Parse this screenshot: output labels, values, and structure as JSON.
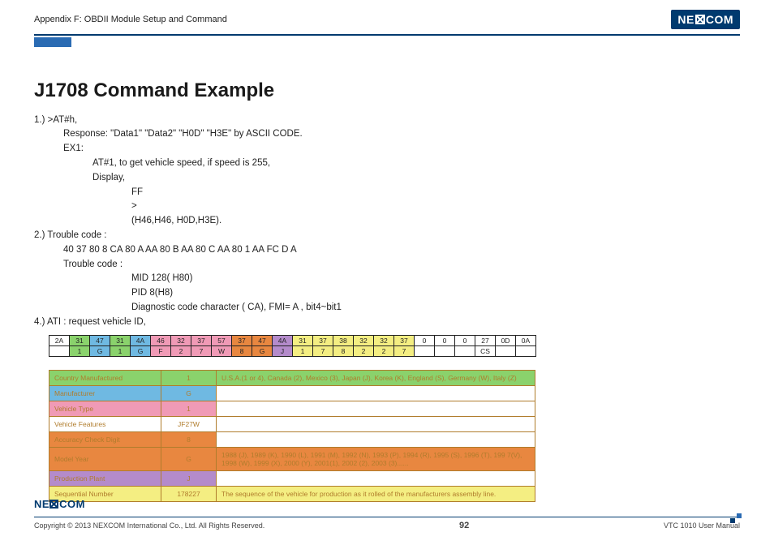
{
  "header": {
    "appendix": "Appendix F: OBDII Module Setup and Command",
    "logo_text": "NEXCOM"
  },
  "title": "J1708 Command Example",
  "lines": {
    "l1": "1.)   >AT#h,",
    "l2": "Response: \"Data1\" \"Data2\" \"H0D\" \"H3E\" by ASCII CODE.",
    "l3": "EX1:",
    "l4": "AT#1, to get vehicle speed, if speed is 255,",
    "l5": "Display,",
    "l6": "FF",
    "l7": ">",
    "l8": "(H46,H46, H0D,H3E).",
    "l9": "2.) Trouble code :",
    "l10": "40 37 80 8 CA 80 A AA 80 B AA 80 C AA 80 1 AA FC D A",
    "l11": "Trouble code :",
    "l12": "MID 128( H80)",
    "l13": "PID 8(H8)",
    "l14": "Diagnostic code character ( CA), FMI= A , bit4~bit1",
    "l15": "4.) ATI : request vehicle ID,"
  },
  "hex_table": {
    "row1": [
      "2A",
      "31",
      "47",
      "31",
      "4A",
      "46",
      "32",
      "37",
      "57",
      "37",
      "47",
      "4A",
      "31",
      "37",
      "38",
      "32",
      "32",
      "37",
      "0",
      "0",
      "0",
      "27",
      "0D",
      "0A"
    ],
    "row2": [
      "",
      "1",
      "G",
      "1",
      "G",
      "F",
      "2",
      "7",
      "W",
      "8",
      "G",
      "J",
      "1",
      "7",
      "8",
      "2",
      "2",
      "7",
      "",
      "",
      "",
      "CS",
      "",
      ""
    ],
    "colors": [
      "white",
      "green",
      "blue",
      "green",
      "blue",
      "pink",
      "pink",
      "pink",
      "pink",
      "orange",
      "orange",
      "purple",
      "yellow",
      "yellow",
      "yellow",
      "yellow",
      "yellow",
      "yellow",
      "white",
      "white",
      "white",
      "white",
      "white",
      "white"
    ]
  },
  "info_table": [
    {
      "label": "Country Manufactured",
      "val": "1",
      "desc": "U.S.A.(1 or 4), Canada (2), Mexico (3), Japan (J), Korea (K), England (S), Germany (W), Italy (Z)",
      "color": "green"
    },
    {
      "label": "Manufacturer",
      "val": "G",
      "desc": "",
      "color": "blue"
    },
    {
      "label": "Vehicle Type",
      "val": "1",
      "desc": "",
      "color": "pink"
    },
    {
      "label": "Vehicle Features",
      "val": "JF27W",
      "desc": "",
      "color": "white"
    },
    {
      "label": "Accuracy Check Digit",
      "val": "8",
      "desc": "",
      "color": "orange"
    },
    {
      "label": "Model Year",
      "val": "G",
      "desc": "1988 (J), 1989 (K), 1990 (L), 1991 (M), 1992 (N), 1993 (P), 1994 (R), 1995 (S), 1996 (T), 199 7(V), 1998 (W), 1999 (X), 2000 (Y), 2001(1), 2002 (2), 2003 (3)......",
      "color": "orange"
    },
    {
      "label": "Production Plant",
      "val": "J",
      "desc": "",
      "color": "purple"
    },
    {
      "label": "Sequential Number",
      "val": "178227",
      "desc": "The sequence of the vehicle for production as it rolled of the manufacturers assembly line.",
      "color": "yellow"
    }
  ],
  "footer": {
    "logo": "NEXCOM",
    "copyright": "Copyright © 2013 NEXCOM International Co., Ltd. All Rights Reserved.",
    "page": "92",
    "manual": "VTC 1010 User Manual"
  }
}
